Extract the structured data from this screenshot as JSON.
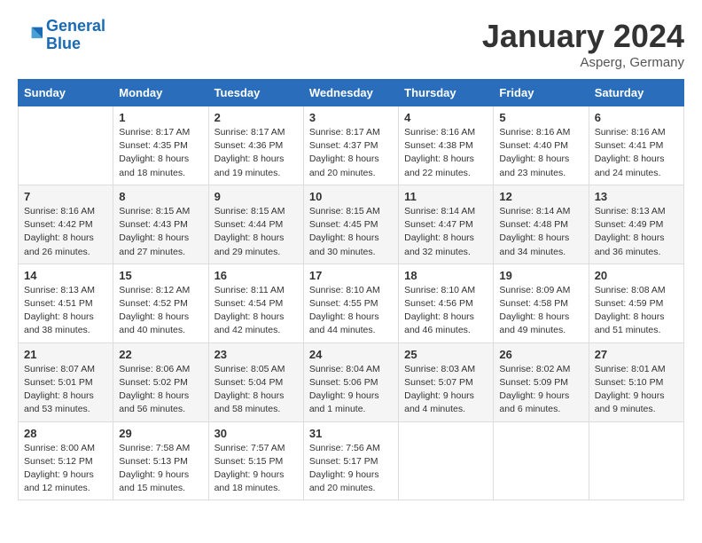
{
  "logo": {
    "line1": "General",
    "line2": "Blue"
  },
  "title": "January 2024",
  "location": "Asperg, Germany",
  "header_days": [
    "Sunday",
    "Monday",
    "Tuesday",
    "Wednesday",
    "Thursday",
    "Friday",
    "Saturday"
  ],
  "weeks": [
    [
      {
        "num": "",
        "info": ""
      },
      {
        "num": "1",
        "info": "Sunrise: 8:17 AM\nSunset: 4:35 PM\nDaylight: 8 hours\nand 18 minutes."
      },
      {
        "num": "2",
        "info": "Sunrise: 8:17 AM\nSunset: 4:36 PM\nDaylight: 8 hours\nand 19 minutes."
      },
      {
        "num": "3",
        "info": "Sunrise: 8:17 AM\nSunset: 4:37 PM\nDaylight: 8 hours\nand 20 minutes."
      },
      {
        "num": "4",
        "info": "Sunrise: 8:16 AM\nSunset: 4:38 PM\nDaylight: 8 hours\nand 22 minutes."
      },
      {
        "num": "5",
        "info": "Sunrise: 8:16 AM\nSunset: 4:40 PM\nDaylight: 8 hours\nand 23 minutes."
      },
      {
        "num": "6",
        "info": "Sunrise: 8:16 AM\nSunset: 4:41 PM\nDaylight: 8 hours\nand 24 minutes."
      }
    ],
    [
      {
        "num": "7",
        "info": "Sunrise: 8:16 AM\nSunset: 4:42 PM\nDaylight: 8 hours\nand 26 minutes."
      },
      {
        "num": "8",
        "info": "Sunrise: 8:15 AM\nSunset: 4:43 PM\nDaylight: 8 hours\nand 27 minutes."
      },
      {
        "num": "9",
        "info": "Sunrise: 8:15 AM\nSunset: 4:44 PM\nDaylight: 8 hours\nand 29 minutes."
      },
      {
        "num": "10",
        "info": "Sunrise: 8:15 AM\nSunset: 4:45 PM\nDaylight: 8 hours\nand 30 minutes."
      },
      {
        "num": "11",
        "info": "Sunrise: 8:14 AM\nSunset: 4:47 PM\nDaylight: 8 hours\nand 32 minutes."
      },
      {
        "num": "12",
        "info": "Sunrise: 8:14 AM\nSunset: 4:48 PM\nDaylight: 8 hours\nand 34 minutes."
      },
      {
        "num": "13",
        "info": "Sunrise: 8:13 AM\nSunset: 4:49 PM\nDaylight: 8 hours\nand 36 minutes."
      }
    ],
    [
      {
        "num": "14",
        "info": "Sunrise: 8:13 AM\nSunset: 4:51 PM\nDaylight: 8 hours\nand 38 minutes."
      },
      {
        "num": "15",
        "info": "Sunrise: 8:12 AM\nSunset: 4:52 PM\nDaylight: 8 hours\nand 40 minutes."
      },
      {
        "num": "16",
        "info": "Sunrise: 8:11 AM\nSunset: 4:54 PM\nDaylight: 8 hours\nand 42 minutes."
      },
      {
        "num": "17",
        "info": "Sunrise: 8:10 AM\nSunset: 4:55 PM\nDaylight: 8 hours\nand 44 minutes."
      },
      {
        "num": "18",
        "info": "Sunrise: 8:10 AM\nSunset: 4:56 PM\nDaylight: 8 hours\nand 46 minutes."
      },
      {
        "num": "19",
        "info": "Sunrise: 8:09 AM\nSunset: 4:58 PM\nDaylight: 8 hours\nand 49 minutes."
      },
      {
        "num": "20",
        "info": "Sunrise: 8:08 AM\nSunset: 4:59 PM\nDaylight: 8 hours\nand 51 minutes."
      }
    ],
    [
      {
        "num": "21",
        "info": "Sunrise: 8:07 AM\nSunset: 5:01 PM\nDaylight: 8 hours\nand 53 minutes."
      },
      {
        "num": "22",
        "info": "Sunrise: 8:06 AM\nSunset: 5:02 PM\nDaylight: 8 hours\nand 56 minutes."
      },
      {
        "num": "23",
        "info": "Sunrise: 8:05 AM\nSunset: 5:04 PM\nDaylight: 8 hours\nand 58 minutes."
      },
      {
        "num": "24",
        "info": "Sunrise: 8:04 AM\nSunset: 5:06 PM\nDaylight: 9 hours\nand 1 minute."
      },
      {
        "num": "25",
        "info": "Sunrise: 8:03 AM\nSunset: 5:07 PM\nDaylight: 9 hours\nand 4 minutes."
      },
      {
        "num": "26",
        "info": "Sunrise: 8:02 AM\nSunset: 5:09 PM\nDaylight: 9 hours\nand 6 minutes."
      },
      {
        "num": "27",
        "info": "Sunrise: 8:01 AM\nSunset: 5:10 PM\nDaylight: 9 hours\nand 9 minutes."
      }
    ],
    [
      {
        "num": "28",
        "info": "Sunrise: 8:00 AM\nSunset: 5:12 PM\nDaylight: 9 hours\nand 12 minutes."
      },
      {
        "num": "29",
        "info": "Sunrise: 7:58 AM\nSunset: 5:13 PM\nDaylight: 9 hours\nand 15 minutes."
      },
      {
        "num": "30",
        "info": "Sunrise: 7:57 AM\nSunset: 5:15 PM\nDaylight: 9 hours\nand 18 minutes."
      },
      {
        "num": "31",
        "info": "Sunrise: 7:56 AM\nSunset: 5:17 PM\nDaylight: 9 hours\nand 20 minutes."
      },
      {
        "num": "",
        "info": ""
      },
      {
        "num": "",
        "info": ""
      },
      {
        "num": "",
        "info": ""
      }
    ]
  ]
}
